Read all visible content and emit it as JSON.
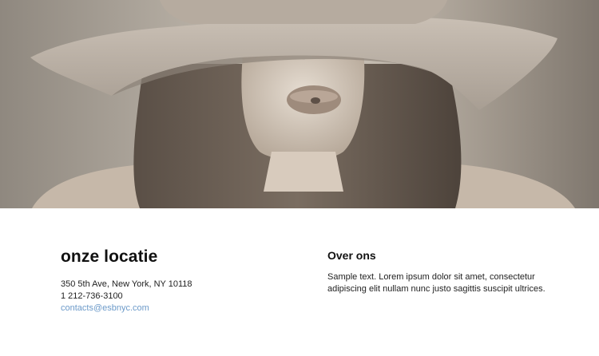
{
  "hero": {
    "image_label": "woman-with-wide-brim-hat-photo"
  },
  "location": {
    "title": "onze locatie",
    "address": "350 5th Ave, New York, NY 10118",
    "phone": "1 212-736-3100",
    "email": "contacts@esbnyc.com"
  },
  "about": {
    "title": "Over ons",
    "text": "Sample text. Lorem ipsum dolor sit amet, consectetur adipiscing elit nullam nunc justo sagittis suscipit ultrices."
  },
  "colors": {
    "link": "#6c9ac9",
    "heading": "#111111",
    "body_text": "#222222"
  }
}
